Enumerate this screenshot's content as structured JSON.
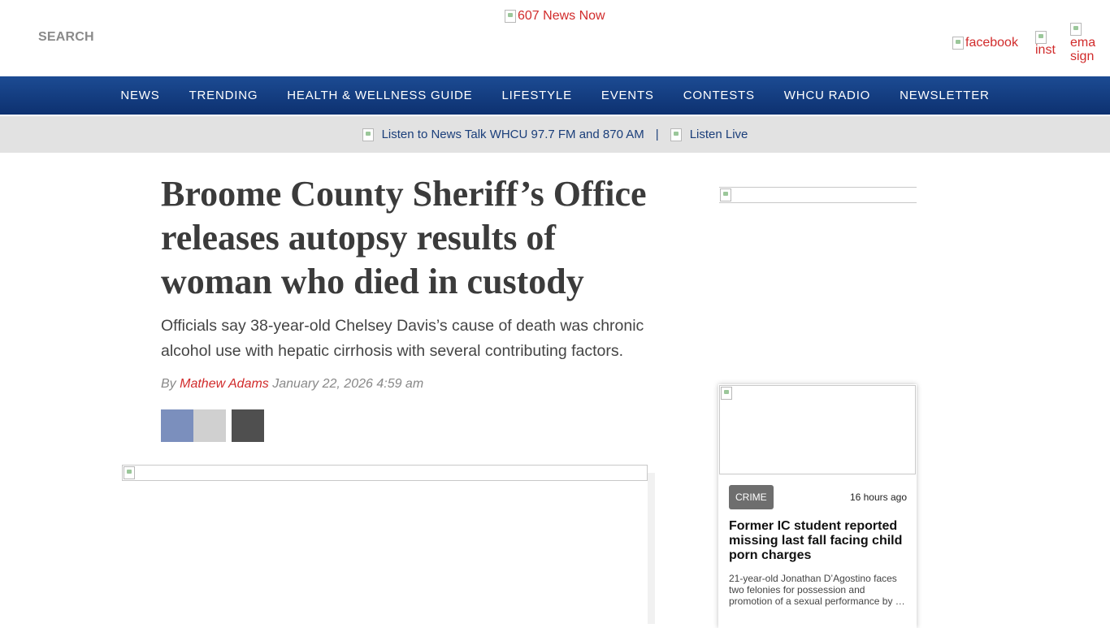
{
  "header": {
    "search_label": "SEARCH",
    "logo_alt": "607 News Now",
    "social": [
      {
        "alt": "facebook"
      },
      {
        "alt": "inst"
      },
      {
        "alt": "ema sign"
      }
    ]
  },
  "nav": {
    "items": [
      "NEWS",
      "TRENDING",
      "HEALTH & WELLNESS GUIDE",
      "LIFESTYLE",
      "EVENTS",
      "CONTESTS",
      "WHCU RADIO",
      "NEWSLETTER"
    ]
  },
  "listen_bar": {
    "station_label": "Listen to News Talk WHCU 97.7 FM and 870 AM",
    "separator": "|",
    "live_label": "Listen Live"
  },
  "article": {
    "headline": "Broome County Sheriff’s Office releases autopsy results of woman who died in custody",
    "dek": "Officials say 38-year-old Chelsey Davis’s cause of death was chronic alcohol use with hepatic cirrhosis with several contributing factors.",
    "byline_prefix": "By",
    "author": "Mathew Adams",
    "date": "January 22, 2026 4:59 am",
    "share_colors": [
      "#7b8fbd",
      "#d0d0d0",
      "#4f4f4f"
    ]
  },
  "sidebar": {
    "card": {
      "category": "CRIME",
      "time_ago": "16 hours ago",
      "title": "Former IC student reported missing last fall facing child porn charges",
      "summary": "21-year-old Jonathan D’Agostino faces two felonies for possession and promotion of a sexual performance by …"
    }
  },
  "colors": {
    "accent_red": "#d12b2b",
    "nav_blue": "#163f84",
    "listen_bar_bg": "#e2e2e2"
  }
}
